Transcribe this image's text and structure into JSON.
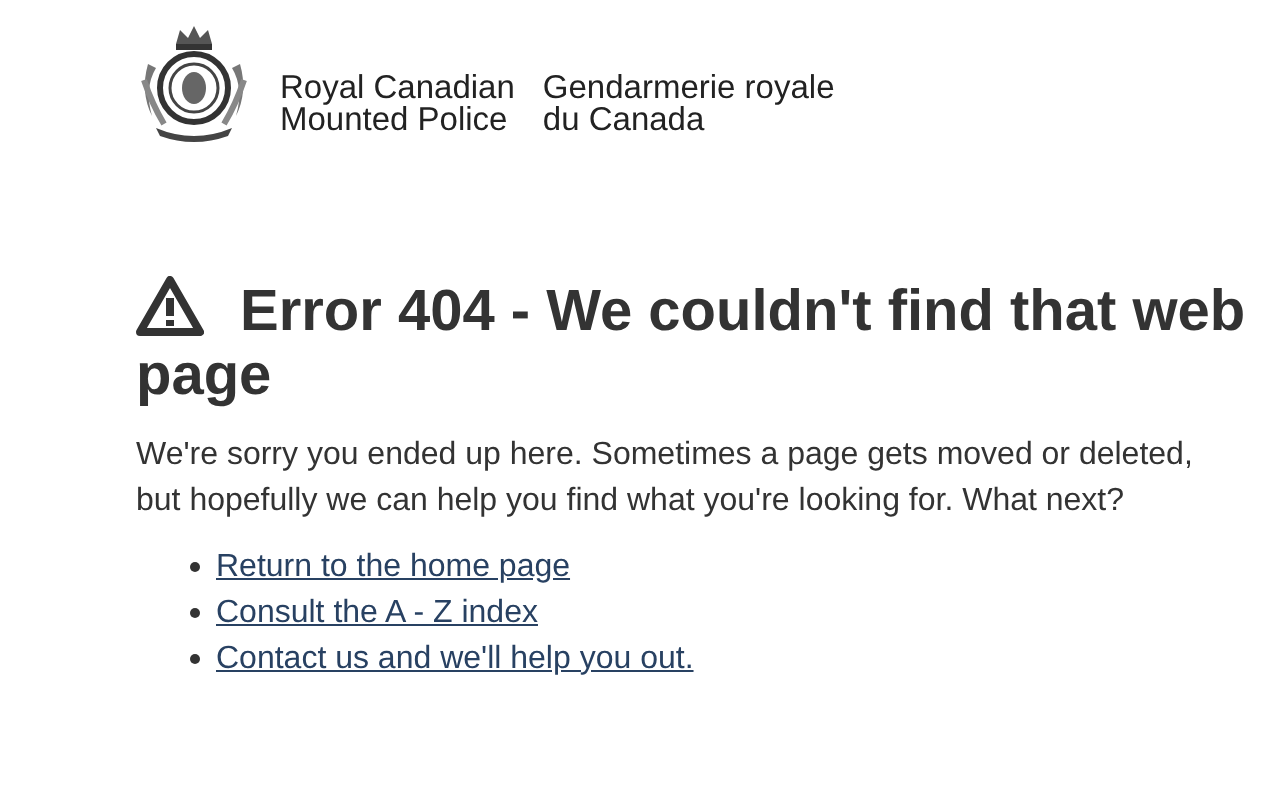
{
  "header": {
    "name_en": [
      "Royal Canadian",
      "Mounted Police"
    ],
    "name_fr": [
      "Gendarmerie royale",
      "du Canada"
    ]
  },
  "error": {
    "title": "Error 404 - We couldn't find that web page",
    "message": "We're sorry you ended up here. Sometimes a page gets moved or deleted, but hopefully we can help you find what you're looking for. What next?",
    "links": [
      "Return to the home page",
      "Consult the A - Z index",
      "Contact us and we'll help you out."
    ]
  }
}
